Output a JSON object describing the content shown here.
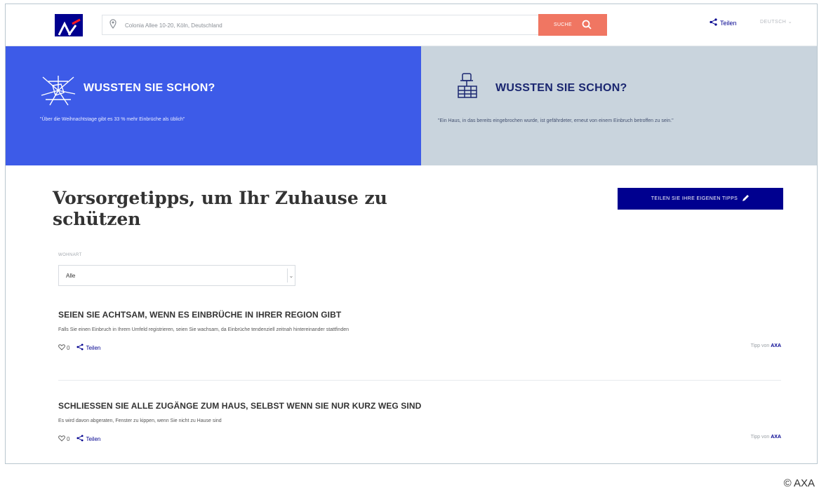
{
  "header": {
    "search_value": "Colonia Allee 10-20, Köln, Deutschland",
    "search_button_label": "SUCHE",
    "share_label": "Teilen",
    "language_label": "DEUTSCH"
  },
  "banners": [
    {
      "title": "WUSSTEN SIE SCHON?",
      "text": "\"Über die Weihnachtstage gibt es 33 % mehr Einbrüche als üblich\"",
      "background": "#3d5be8"
    },
    {
      "title": "WUSSTEN SIE SCHON?",
      "text": "\"Ein Haus, in das bereits eingebrochen wurde, ist gefährdeter, erneut von einem Einbruch betroffen zu sein.\"",
      "background": "#c9d4dd"
    }
  ],
  "main": {
    "title": "Vorsorgetipps, um Ihr Zuhause zu schützen",
    "share_tips_button": "TEILEN SIE IHRE EIGENEN TIPPS",
    "filter": {
      "label": "WOHNART",
      "selected": "Alle"
    }
  },
  "tips": [
    {
      "title": "SEIEN SIE ACHTSAM, WENN ES EINBRÜCHE IN IHRER REGION GIBT",
      "description": "Falls Sie einen Einbruch in Ihrem Umfeld registrieren, seien Sie wachsam, da Einbrüche tendenziell zeitnah hintereinander stattfinden",
      "likes": "0",
      "share_label": "Teilen",
      "byline_prefix": "Tipp von",
      "byline_author": "AXA"
    },
    {
      "title": "SCHLIESSEN SIE ALLE ZUGÄNGE ZUM HAUS, SELBST WENN SIE NUR KURZ WEG SIND",
      "description": "Es wird davon abgeraten, Fenster zu kippen, wenn Sie nicht zu Hause sind",
      "likes": "0",
      "share_label": "Teilen",
      "byline_prefix": "Tipp von",
      "byline_author": "AXA"
    }
  ],
  "copyright": "© AXA",
  "colors": {
    "brand": "#00008f",
    "search_button": "#f07662",
    "banner_blue": "#3d5be8",
    "banner_grey": "#c9d4dd"
  },
  "icons": {
    "logo": "axa-logo",
    "search_pin": "location-pin-icon",
    "search": "search-icon",
    "share": "share-icon",
    "banner_left": "broken-glass-icon",
    "banner_right": "door-lock-icon",
    "edit": "pencil-icon",
    "like": "heart-icon"
  }
}
